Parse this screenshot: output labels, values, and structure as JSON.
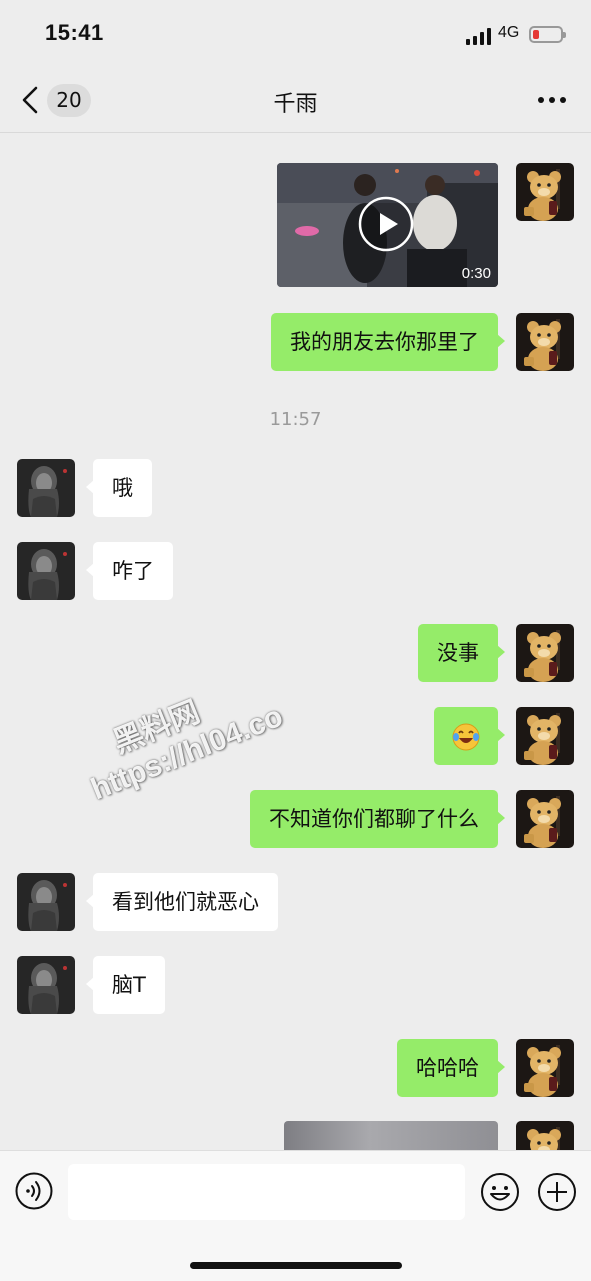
{
  "status_bar": {
    "time": "15:41",
    "network": "4G",
    "battery_color": "#e53935"
  },
  "nav": {
    "back_icon": "chevron-left-icon",
    "unread_count": "20",
    "title": "千雨",
    "more_icon": "more-dots-icon"
  },
  "chat": {
    "colors": {
      "sent_bubble": "#95ec69",
      "received_bubble": "#ffffff",
      "background": "#ededed"
    },
    "timestamp": "11:57",
    "video": {
      "duration": "0:30",
      "play_icon": "play-icon"
    },
    "messages": [
      {
        "from": "me",
        "text": "我的朋友去你那里了"
      },
      {
        "from": "them",
        "text": "哦"
      },
      {
        "from": "them",
        "text": "咋了"
      },
      {
        "from": "me",
        "text": "没事"
      },
      {
        "from": "me",
        "emoji": "laughing-crying-emoji"
      },
      {
        "from": "me",
        "text": "不知道你们都聊了什么"
      },
      {
        "from": "them",
        "text": "看到他们就恶心"
      },
      {
        "from": "them",
        "text": "脑T"
      },
      {
        "from": "me",
        "text": "哈哈哈"
      }
    ]
  },
  "watermark": {
    "line1": "黑料网",
    "line2": "https://hl04.co"
  },
  "input_bar": {
    "voice_icon": "voice-icon",
    "emoji_icon": "emoji-icon",
    "plus_icon": "plus-icon"
  }
}
